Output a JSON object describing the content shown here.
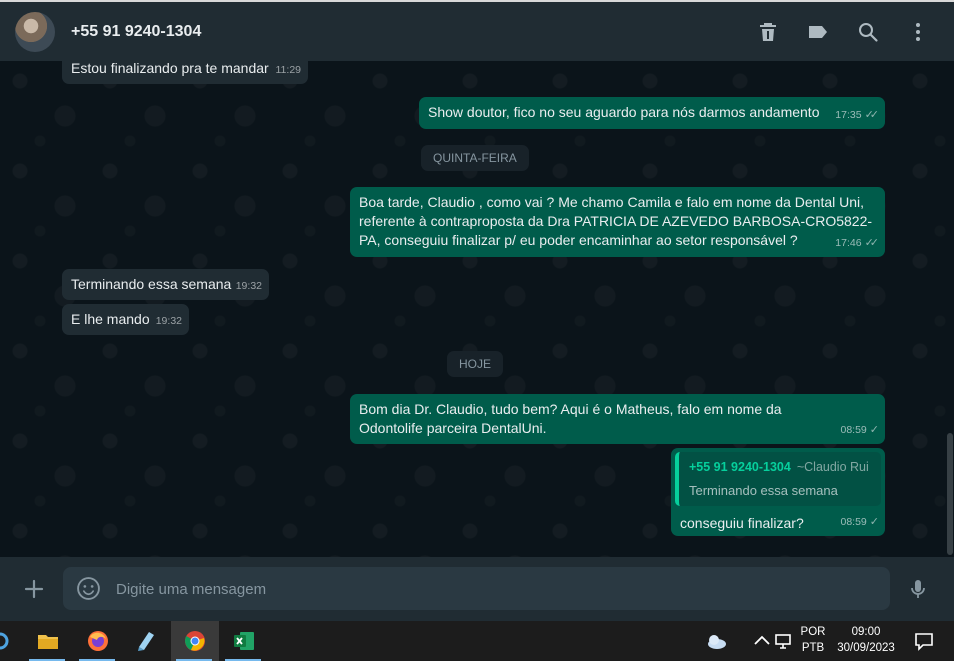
{
  "header": {
    "contact_name": "+55 91 9240-1304",
    "icons": [
      "trash-icon",
      "label-icon",
      "search-icon",
      "more-vertical-icon"
    ]
  },
  "messages": [
    {
      "id": "m0",
      "direction": "in",
      "text": "Estou finalizando pra te mandar",
      "time": "11:29"
    },
    {
      "id": "m1",
      "direction": "out",
      "text": "Show doutor, fico no seu aguardo para nós darmos andamento",
      "time": "17:35",
      "status": "read"
    },
    {
      "id": "m2",
      "direction": "out",
      "text": "Boa tarde, Claudio , como vai ? Me chamo Camila e falo em nome da Dental Uni, referente à contraproposta da Dra PATRICIA DE AZEVEDO BARBOSA-CRO5822-PA, conseguiu finalizar p/ eu poder encaminhar ao setor responsável ?",
      "time": "17:46",
      "status": "read"
    },
    {
      "id": "m3",
      "direction": "in",
      "text": "Terminando essa semana",
      "time": "19:32"
    },
    {
      "id": "m4",
      "direction": "in",
      "text": "E lhe mando",
      "time": "19:32"
    },
    {
      "id": "m5",
      "direction": "out",
      "text": "Bom dia Dr. Claudio, tudo bem? Aqui é o Matheus, falo em nome da Odontolife parceira DentalUni.",
      "time": "08:59",
      "status": "sent"
    },
    {
      "id": "m6",
      "direction": "out",
      "text": "conseguiu finalizar?",
      "time": "08:59",
      "status": "sent",
      "quote": {
        "author": "+55 91 9240-1304",
        "alias": "~Claudio Rui",
        "text": "Terminando essa semana"
      }
    }
  ],
  "day_separators": [
    "QUINTA-FEIRA",
    "HOJE"
  ],
  "composer": {
    "placeholder": "Digite uma mensagem"
  },
  "taskbar": {
    "apps": [
      "file-explorer-icon",
      "firefox-icon",
      "notepad-icon",
      "chrome-icon",
      "excel-icon"
    ],
    "language": "POR",
    "keyboard": "PTB",
    "time": "09:00",
    "date": "30/09/2023"
  },
  "colors": {
    "header_bg": "#202c33",
    "chat_bg": "#0b141a",
    "incoming_bubble": "#202c33",
    "outgoing_bubble": "#005c4b",
    "accent": "#06cf9c"
  }
}
